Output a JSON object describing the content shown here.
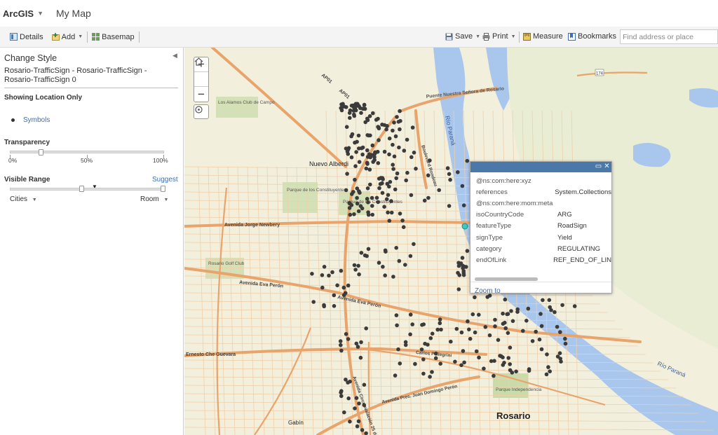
{
  "header": {
    "app_name": "ArcGIS",
    "map_title": "My Map"
  },
  "toolbar": {
    "details": "Details",
    "add": "Add",
    "basemap": "Basemap",
    "save": "Save",
    "print": "Print",
    "measure": "Measure",
    "bookmarks": "Bookmarks",
    "search_placeholder": "Find address or place"
  },
  "panel": {
    "title": "Change Style",
    "layer_name": "Rosario-TrafficSign - Rosario-TrafficSign - Rosario-TrafficSign 0",
    "showing": "Showing Location Only",
    "symbols_link": "Symbols",
    "transparency_label": "Transparency",
    "transparency_value": 0.2,
    "tick_0": "0%",
    "tick_50": "50%",
    "tick_100": "100%",
    "visible_range_label": "Visible Range",
    "suggest": "Suggest",
    "range_min": "Cities",
    "range_max": "Room"
  },
  "popup": {
    "rows": [
      {
        "k": "@ns:com:here:xyz",
        "v": ""
      },
      {
        "k": "references",
        "v": "System.Collections"
      },
      {
        "k": "@ns:com:here:mom:meta",
        "v": ""
      },
      {
        "k": "isoCountryCode",
        "v": "ARG"
      },
      {
        "k": "featureType",
        "v": "RoadSign"
      },
      {
        "k": "signType",
        "v": "Yield"
      },
      {
        "k": "category",
        "v": "REGULATING"
      },
      {
        "k": "endOfLink",
        "v": "REF_END_OF_LIN"
      }
    ],
    "zoom_to": "Zoom to"
  },
  "map": {
    "labels": {
      "nuevo_alberdi": "Nuevo Alberdi",
      "rosario": "Rosario",
      "rio_parana": "Río Paraná",
      "rio_parana2": "Río Paraná",
      "puente": "Puente Nuestra Señora de Rosario",
      "jorge_newbery": "Avenida Jorge Newbery",
      "eva_peron": "Avenida Eva Perón",
      "che_guevara": "Ernesto Che Guevara",
      "gabin": "Gabín",
      "parque_const": "Parque de los Constituyentes",
      "parque_indep": "Parque Independencia",
      "los_alamos": "Los Alamos Club de Campo",
      "golf": "Rosario Golf Club",
      "circunvalacion": "Avenida Circunvalación 25 de Mayo",
      "ap01": "AP01",
      "route": "174",
      "rondeau": "Boulevard Rondeau",
      "pellegrini": "Carlos Pellegrini",
      "pres_peron": "Avenida Pres. Juan Domingo Perón"
    },
    "accent_road": "#e8a46b",
    "water": "#a9c6ec",
    "point_color": "#3b3b3b"
  }
}
